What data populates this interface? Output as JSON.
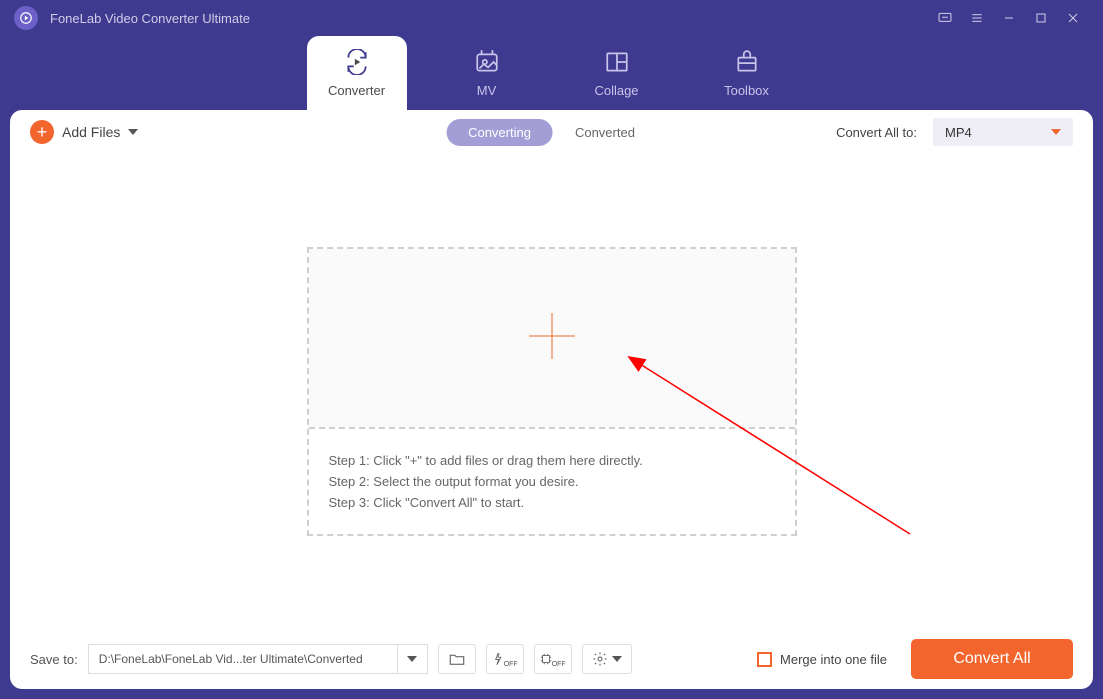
{
  "titlebar": {
    "app_title": "FoneLab Video Converter Ultimate"
  },
  "nav": {
    "tabs": [
      {
        "label": "Converter",
        "active": true
      },
      {
        "label": "MV",
        "active": false
      },
      {
        "label": "Collage",
        "active": false
      },
      {
        "label": "Toolbox",
        "active": false
      }
    ]
  },
  "toolbar": {
    "add_files_label": "Add Files",
    "seg": {
      "converting": "Converting",
      "converted": "Converted",
      "active": "Converting"
    },
    "convert_all_to_label": "Convert All to:",
    "format_selected": "MP4"
  },
  "dropzone": {
    "steps": [
      "Step 1: Click \"+\" to add files or drag them here directly.",
      "Step 2: Select the output format you desire.",
      "Step 3: Click \"Convert All\" to start."
    ]
  },
  "bottombar": {
    "save_to_label": "Save to:",
    "save_path": "D:\\FoneLab\\FoneLab Vid...ter Ultimate\\Converted",
    "gpu_off_sub": "OFF",
    "hw_off_sub": "OFF",
    "merge_label": "Merge into one file",
    "convert_all_btn": "Convert All"
  }
}
